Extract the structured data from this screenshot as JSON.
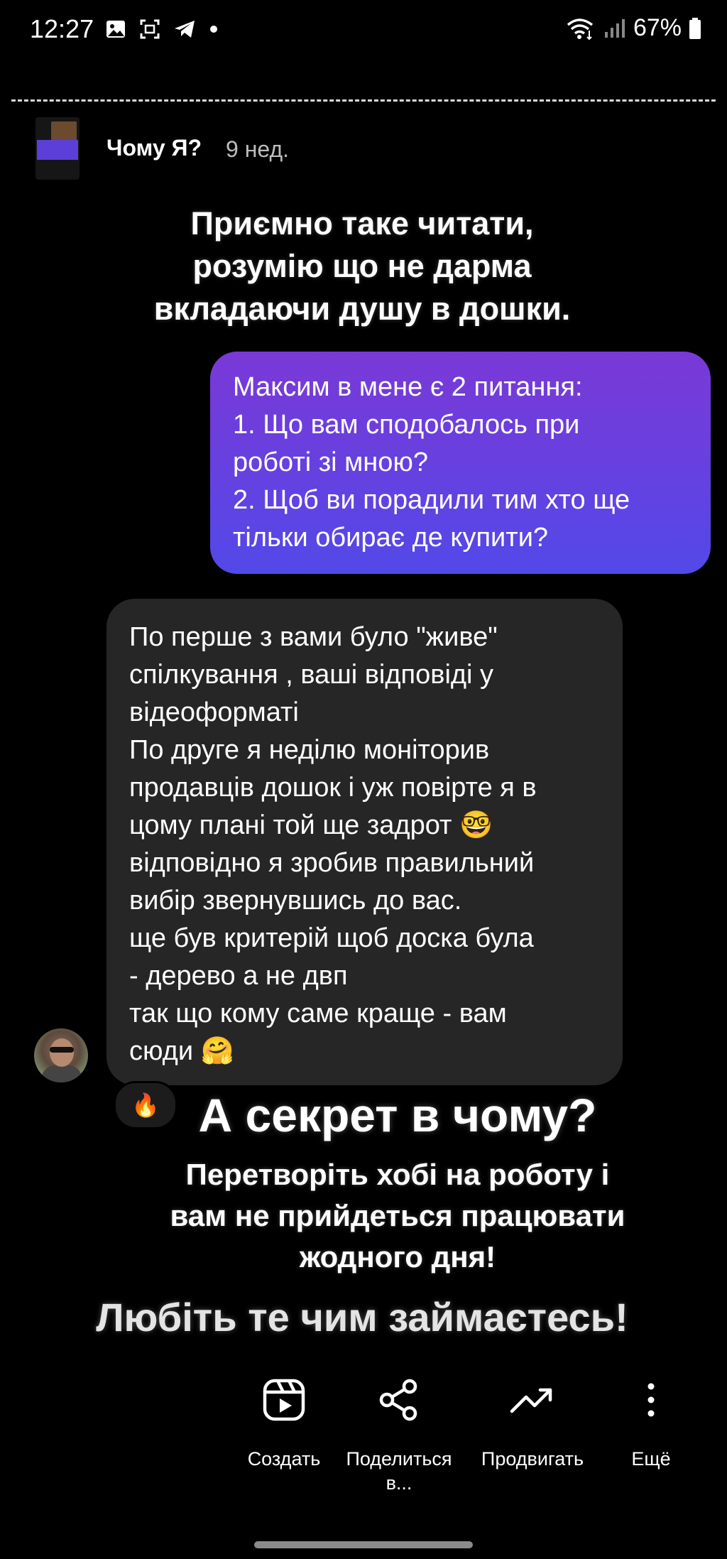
{
  "status_bar": {
    "time": "12:27",
    "battery": "67%"
  },
  "post": {
    "title": "Чому Я?",
    "age": "9 нед."
  },
  "caption_top": [
    "Приємно таке читати,",
    "розумію що не дарма",
    "вкладаючи душу в дошки."
  ],
  "message_out": [
    "Максим в мене є 2 питання:",
    "1. Що вам сподобалось при",
    "роботі зі мною?",
    "2. Щоб ви порадили тим хто ще",
    "тільки обирає де купити?"
  ],
  "message_in": [
    "По перше з вами було \"живе\"",
    "спілкування , ваші відповіді у",
    "відеоформаті",
    "По друге я неділю моніторив",
    "продавців дошок і уж повірте я в",
    "цому плані той ще задрот 🤓",
    "відповідно я зробив правильний",
    "вибір звернувшись до вас.",
    "ще був критерій щоб доска була",
    "- дерево а не двп",
    "так що кому саме краще - вам",
    "сюди 🤗"
  ],
  "reaction": "🔥",
  "caption_secret": "А секрет в чому?",
  "caption_hobby": [
    "Перетворіть хобі на роботу і",
    "вам не прийдеться працювати",
    "жодного дня!"
  ],
  "caption_love": "Любіть те чим займаєтесь!",
  "actions": {
    "create": "Создать",
    "share_line1": "Поделиться",
    "share_line2": "в...",
    "promote": "Продвигать",
    "more": "Ещё"
  }
}
